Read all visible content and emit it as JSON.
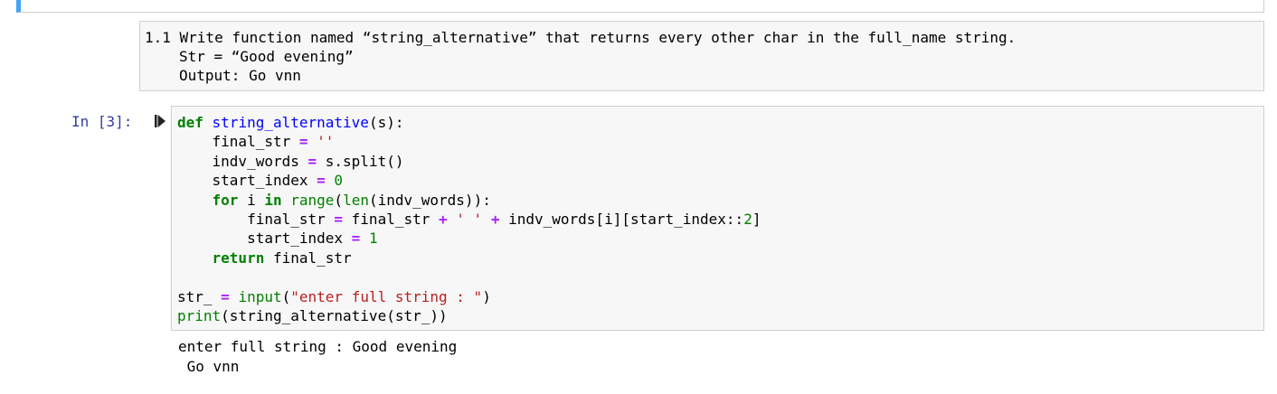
{
  "markdown_cell": {
    "lines": [
      "1.1 Write function named “string_alternative” that returns every other char in the full_name string.",
      "Str = “Good evening”",
      "Output: Go vnn"
    ]
  },
  "code_cell": {
    "prompt": "In [3]:",
    "run_icon": "run-triangle-icon",
    "code": {
      "l1": {
        "kw": "def",
        "fn": "string_alternative",
        "rest": "(s):"
      },
      "l2": {
        "a": "    final_str ",
        "op": "=",
        "str": "''"
      },
      "l3": {
        "a": "    indv_words ",
        "op": "=",
        "b": " s.split()"
      },
      "l4": {
        "a": "    start_index ",
        "op": "=",
        "num": "0"
      },
      "l5": {
        "kw1": "for",
        "a": " i ",
        "kw2": "in",
        "bi1": "range",
        "b": "(",
        "bi2": "len",
        "c": "(indv_words)):"
      },
      "l6": {
        "a": "        final_str ",
        "op1": "=",
        "b": " final_str ",
        "op2": "+",
        "str": "' '",
        "op3": "+",
        "c": " indv_words[i][start_index::",
        "num": "2",
        "d": "]"
      },
      "l7": {
        "a": "        start_index ",
        "op": "=",
        "num": "1"
      },
      "l8": {
        "kw": "return",
        "a": " final_str"
      },
      "l10": {
        "a": "str_ ",
        "op": "=",
        "bi": "input",
        "b": "(",
        "str": "\"enter full string : \"",
        "c": ")"
      },
      "l11": {
        "bi": "print",
        "a": "(string_alternative(str_))"
      }
    }
  },
  "output": {
    "lines": [
      "enter full string : Good evening",
      " Go vnn"
    ]
  },
  "colors": {
    "prompt": "#303f9f",
    "selected_cell_border": "#42a5f5",
    "cell_background": "#f7f7f7"
  }
}
